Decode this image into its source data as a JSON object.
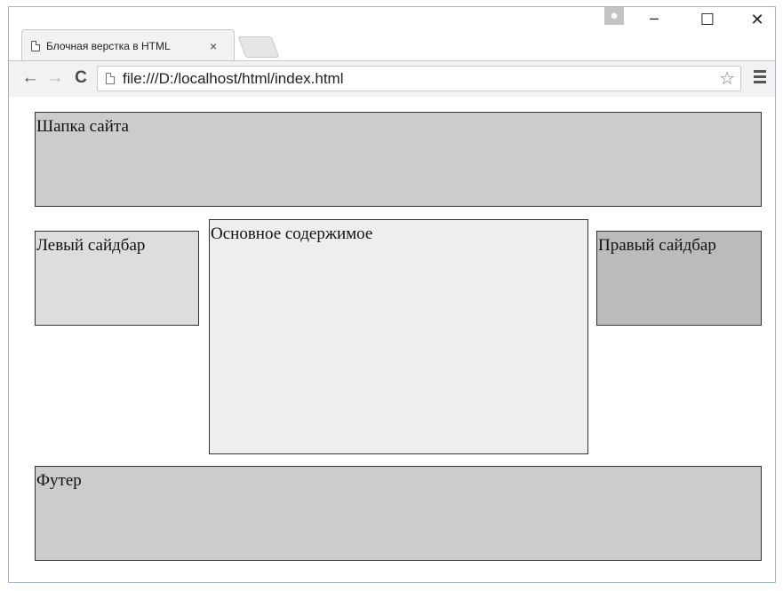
{
  "browser": {
    "tab_title": "Блочная верстка в HTML",
    "tab_close": "×",
    "profile_icon": "person-icon",
    "window_controls": {
      "minimize": "–",
      "maximize": "☐",
      "close": "✕"
    },
    "nav": {
      "back": "←",
      "forward": "→",
      "reload": "C"
    },
    "address": "file:///D:/localhost/html/index.html",
    "bookmark_icon": "☆"
  },
  "page": {
    "header": "Шапка сайта",
    "left_sidebar": "Левый сайдбар",
    "main_content": "Основное содержимое",
    "right_sidebar": "Правый сайдбар",
    "footer": "Футер"
  },
  "colors": {
    "header_bg": "#cccccc",
    "left_sidebar_bg": "#dddddd",
    "main_bg": "#eeeeee",
    "right_sidebar_bg": "#bbbbbb",
    "footer_bg": "#cccccc"
  }
}
